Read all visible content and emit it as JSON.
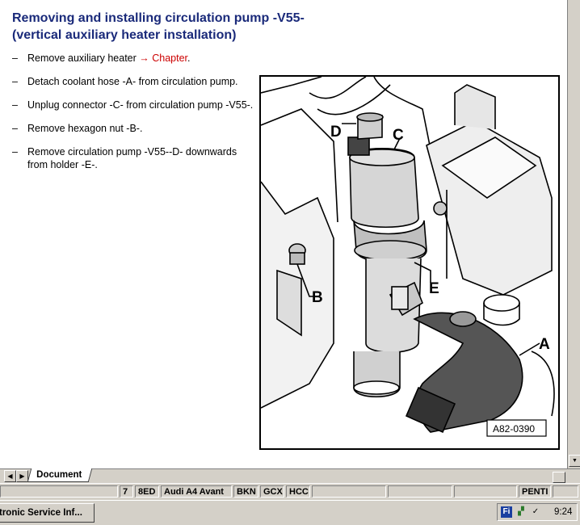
{
  "document": {
    "title_line1": "Removing and installing circulation pump -V55-",
    "title_line2": "(vertical auxiliary heater installation)",
    "steps": [
      {
        "text": "Remove auxiliary heater ",
        "link": "→ Chapter",
        "after": "."
      },
      {
        "text": "Detach coolant hose -A- from circulation pump."
      },
      {
        "text": "Unplug connector -C- from circulation pump -V55-."
      },
      {
        "text": "Remove hexagon nut -B-."
      },
      {
        "text": "Remove circulation pump -V55--D- downwards from holder -E-."
      }
    ],
    "dash": "–"
  },
  "figure": {
    "labels": {
      "a": "A",
      "b": "B",
      "c": "C",
      "d": "D",
      "e": "E"
    },
    "ref_code": "A82-0390"
  },
  "tabs": {
    "active_label": "Document",
    "prev_icon": "triangle-left-icon",
    "next_icon": "triangle-right-icon"
  },
  "status": {
    "cells": [
      "7",
      "8ED",
      "Audi A4 Avant",
      "BKN",
      "GCX",
      "HCC",
      "",
      "",
      "",
      "PENTI",
      ""
    ]
  },
  "taskbar": {
    "app_label": "tronic Service Inf...",
    "tray_badge": "Fi",
    "clock": "9:24"
  }
}
